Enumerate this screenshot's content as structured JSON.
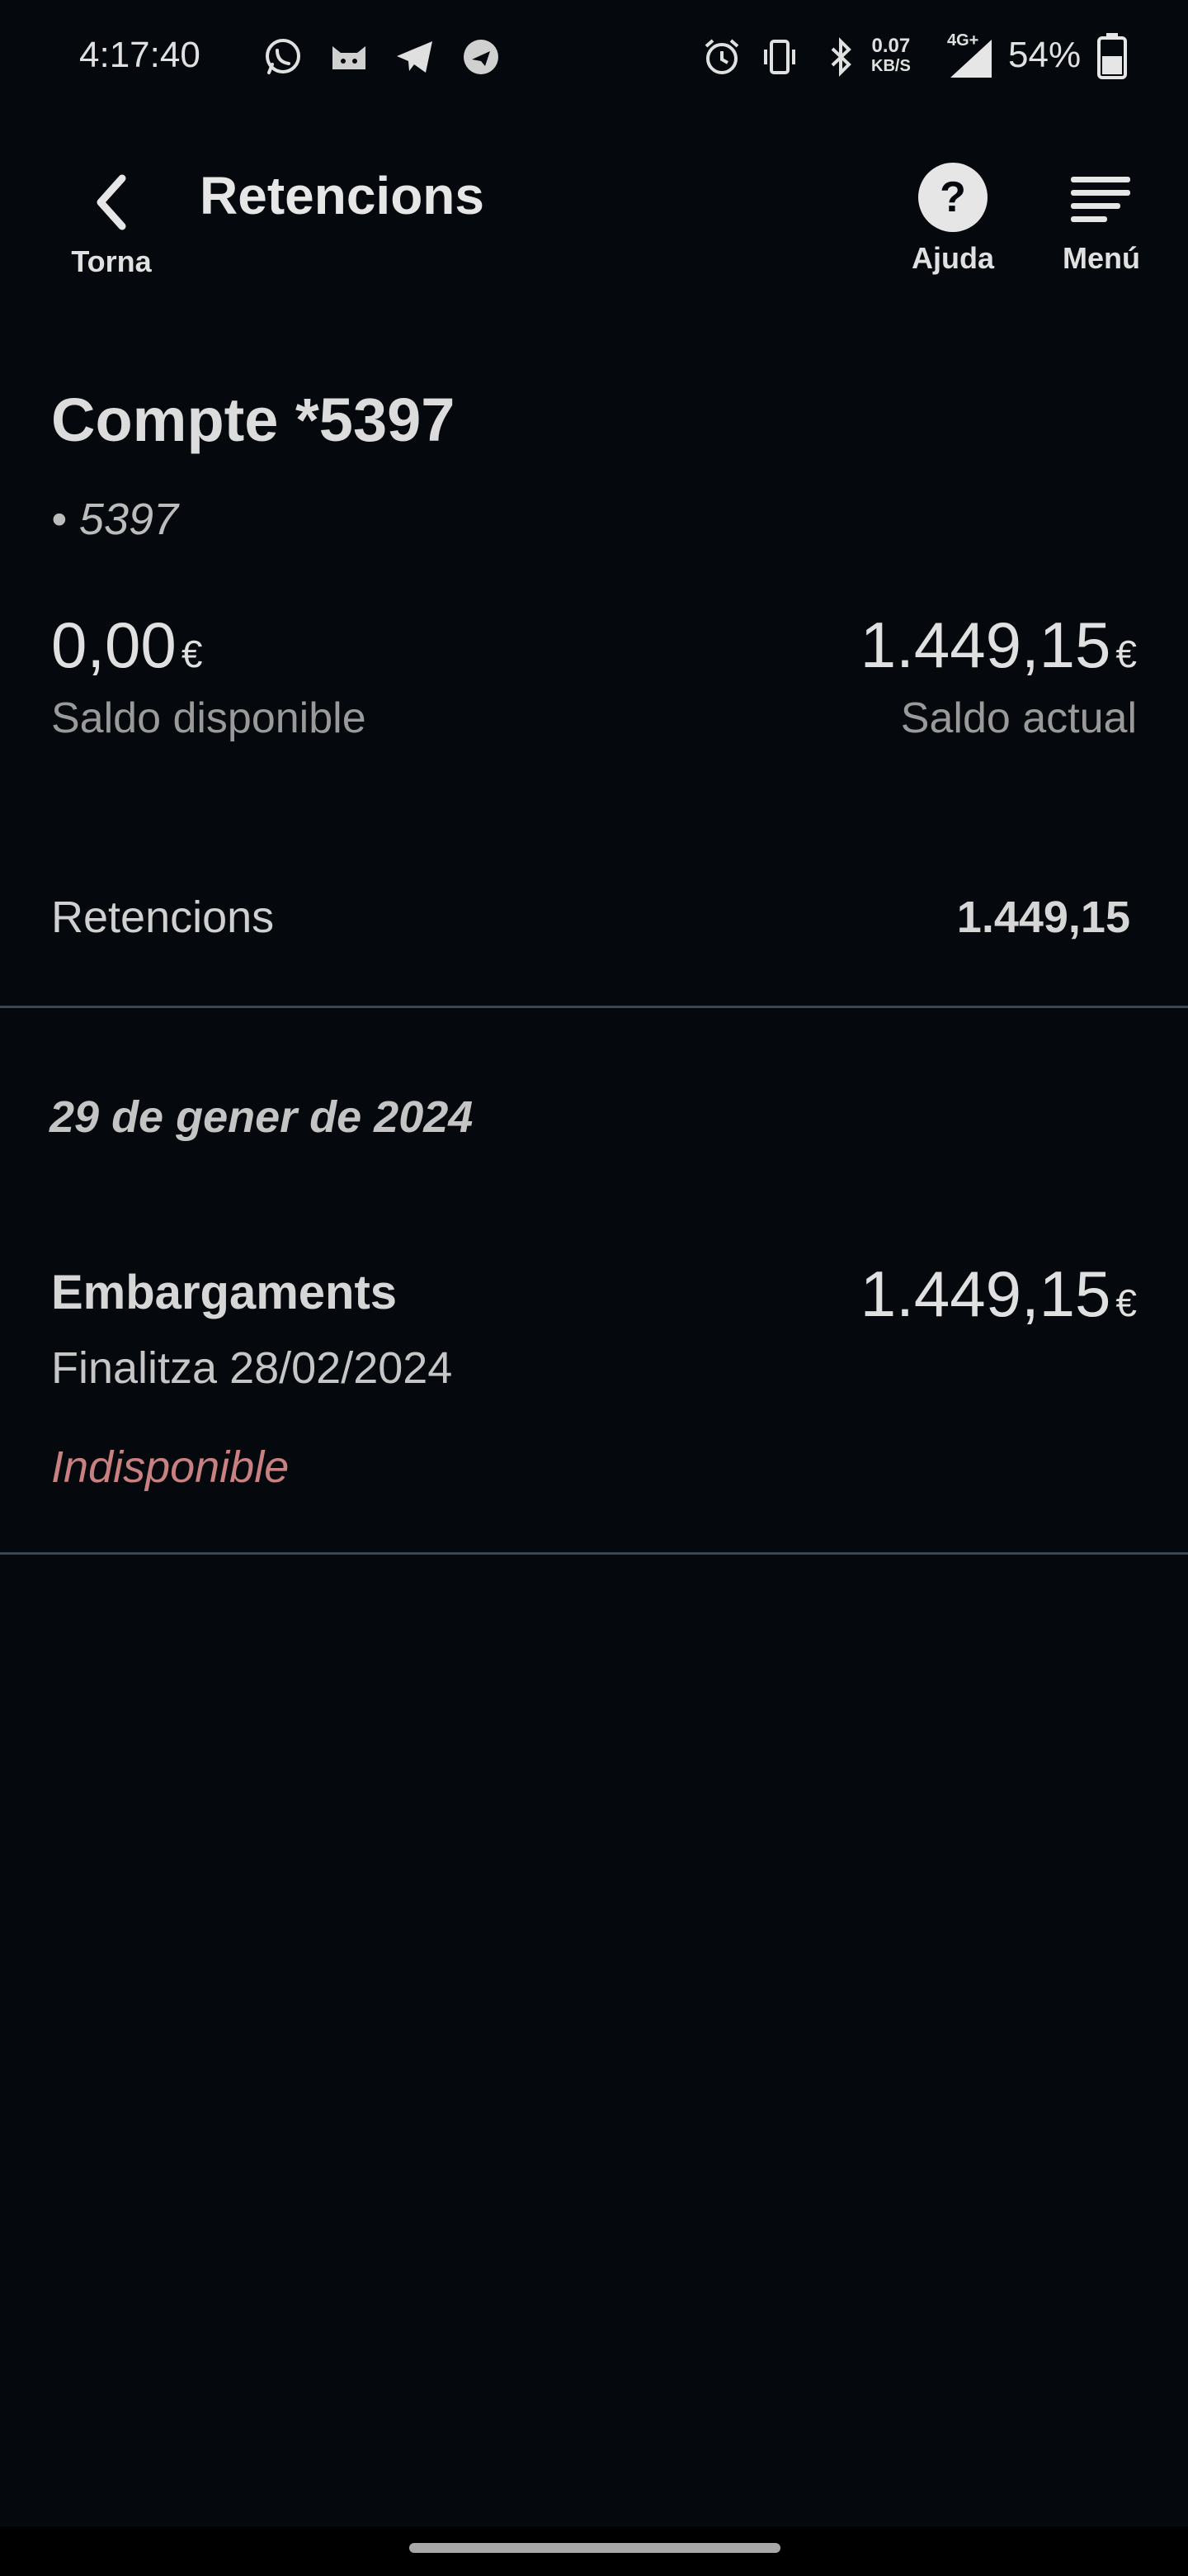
{
  "status_bar": {
    "time": "4:17:40",
    "net_speed_value": "0.07",
    "net_speed_unit": "KB/S",
    "network_type": "4G+",
    "battery": "54%",
    "icons": [
      "whatsapp-icon",
      "cat-app-icon",
      "telegram-icon",
      "browser-icon",
      "alarm-icon",
      "vibrate-icon",
      "bluetooth-icon",
      "signal-icon",
      "battery-icon"
    ]
  },
  "header": {
    "back_label": "Torna",
    "title": "Retencions",
    "help_label": "Ajuda",
    "menu_label": "Menú"
  },
  "account": {
    "title": "Compte *5397",
    "subtitle": "• 5397",
    "available_amount": "0,00",
    "available_currency": "€",
    "available_label": "Saldo disponible",
    "current_amount": "1.449,15",
    "current_currency": "€",
    "current_label": "Saldo actual"
  },
  "retentions": {
    "label": "Retencions",
    "total": "1.449,15"
  },
  "groups": [
    {
      "date": "29 de gener de 2024",
      "items": [
        {
          "title": "Embargaments",
          "subtitle": "Finalitza 28/02/2024",
          "status": "Indisponible",
          "amount": "1.449,15",
          "currency": "€"
        }
      ]
    }
  ],
  "colors": {
    "background": "#05080c",
    "divider": "#3a4550",
    "status_unavailable": "#c98080"
  }
}
